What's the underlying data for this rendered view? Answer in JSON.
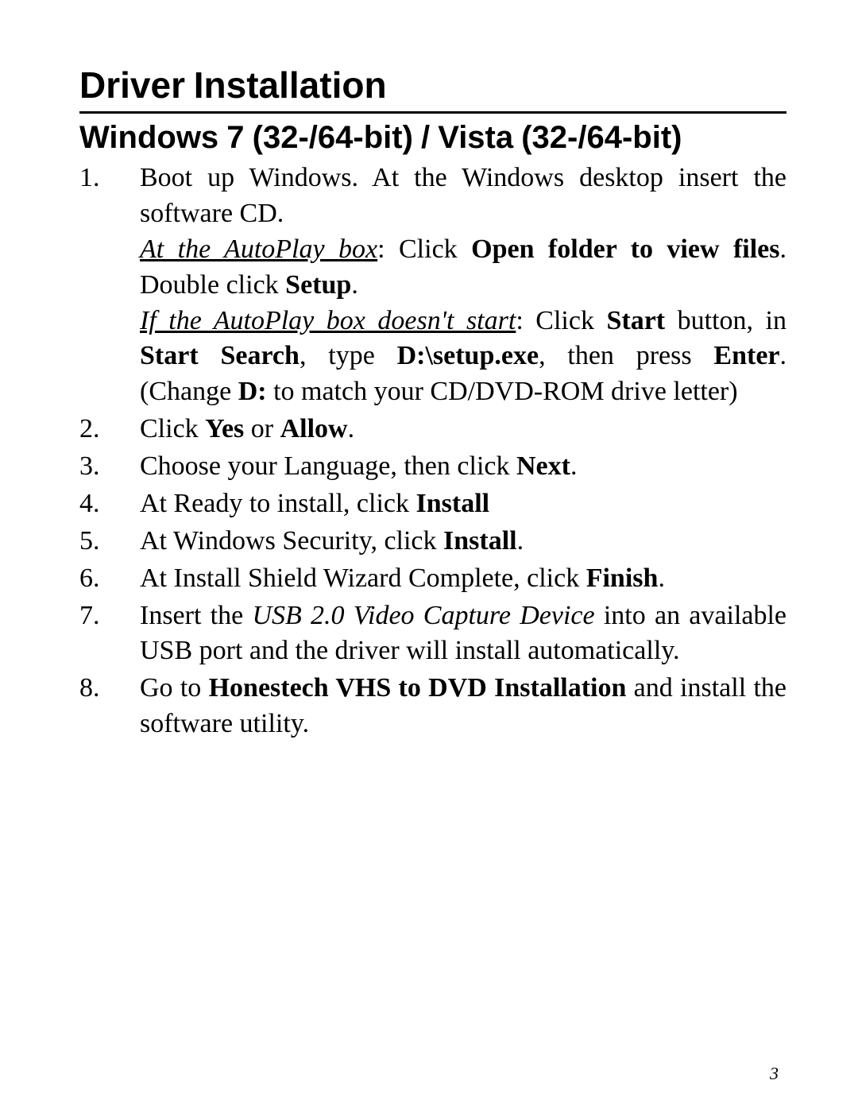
{
  "title": "Driver Installation",
  "subtitle": "Windows 7 (32-/64-bit) / Vista (32-/64-bit)",
  "steps": [
    {
      "n": "1.",
      "body": [
        {
          "runs": [
            {
              "t": "Boot up Windows.  At the Windows desktop insert the software CD."
            }
          ]
        },
        {
          "runs": [
            {
              "t": "At the AutoPlay box",
              "cls": "iu"
            },
            {
              "t": ": Click "
            },
            {
              "t": "Open folder to view files",
              "cls": "b"
            },
            {
              "t": ".  Double click "
            },
            {
              "t": "Setup",
              "cls": "b"
            },
            {
              "t": "."
            }
          ]
        },
        {
          "runs": [
            {
              "t": "If the AutoPlay box doesn't start",
              "cls": "iu"
            },
            {
              "t": ": Click "
            },
            {
              "t": "Start",
              "cls": "b"
            },
            {
              "t": " button, in "
            },
            {
              "t": "Start Search",
              "cls": "b"
            },
            {
              "t": ", type "
            },
            {
              "t": "D:\\setup.exe",
              "cls": "b"
            },
            {
              "t": ", then press "
            },
            {
              "t": "Enter",
              "cls": "b"
            },
            {
              "t": ".  (Change "
            },
            {
              "t": "D:",
              "cls": "b"
            },
            {
              "t": " to match your CD/DVD-ROM drive letter)"
            }
          ]
        }
      ]
    },
    {
      "n": "2.",
      "body": [
        {
          "runs": [
            {
              "t": "Click "
            },
            {
              "t": "Yes",
              "cls": "b"
            },
            {
              "t": " or "
            },
            {
              "t": "Allow",
              "cls": "b"
            },
            {
              "t": "."
            }
          ]
        }
      ]
    },
    {
      "n": "3.",
      "body": [
        {
          "runs": [
            {
              "t": "Choose your Language, then click "
            },
            {
              "t": "Next",
              "cls": "b"
            },
            {
              "t": "."
            }
          ]
        }
      ]
    },
    {
      "n": "4.",
      "body": [
        {
          "runs": [
            {
              "t": "At Ready to install, click "
            },
            {
              "t": "Install",
              "cls": "b"
            }
          ]
        }
      ]
    },
    {
      "n": "5.",
      "body": [
        {
          "runs": [
            {
              "t": "At Windows Security, click "
            },
            {
              "t": "Install",
              "cls": "b"
            },
            {
              "t": "."
            }
          ]
        }
      ]
    },
    {
      "n": "6.",
      "body": [
        {
          "runs": [
            {
              "t": "At Install Shield Wizard Complete, click "
            },
            {
              "t": "Finish",
              "cls": "b"
            },
            {
              "t": "."
            }
          ]
        }
      ]
    },
    {
      "n": "7.",
      "body": [
        {
          "runs": [
            {
              "t": "Insert the "
            },
            {
              "t": "USB 2.0 Video Capture Device",
              "cls": "i"
            },
            {
              "t": " into an available USB port and the driver will install automatically."
            }
          ]
        }
      ]
    },
    {
      "n": "8.",
      "body": [
        {
          "runs": [
            {
              "t": "Go to "
            },
            {
              "t": "Honestech VHS to DVD Installation",
              "cls": "b"
            },
            {
              "t": " and install the software utility."
            }
          ]
        }
      ]
    }
  ],
  "page_number": "3"
}
